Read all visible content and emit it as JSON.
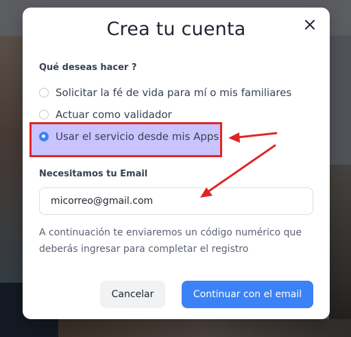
{
  "modal": {
    "title": "Crea tu cuenta",
    "close_icon": "close-icon",
    "question_label": "Qué deseas hacer ?",
    "options": [
      {
        "label": "Solicitar la fé de vida para mí o mis familiares",
        "selected": false
      },
      {
        "label": "Actuar como validador",
        "selected": false
      },
      {
        "label": "Usar el servicio desde mis Apps",
        "selected": true
      }
    ],
    "email_label": "Necesitamos tu Email",
    "email_value": "micorreo@gmail.com",
    "helper_text": "A continuación te enviaremos un código numérico que deberás ingresar para completar el registro",
    "cancel_label": "Cancelar",
    "continue_label": "Continuar con el email"
  },
  "colors": {
    "accent": "#3b82f6",
    "annotation": "#e02424",
    "highlight": "#9c94ff"
  }
}
